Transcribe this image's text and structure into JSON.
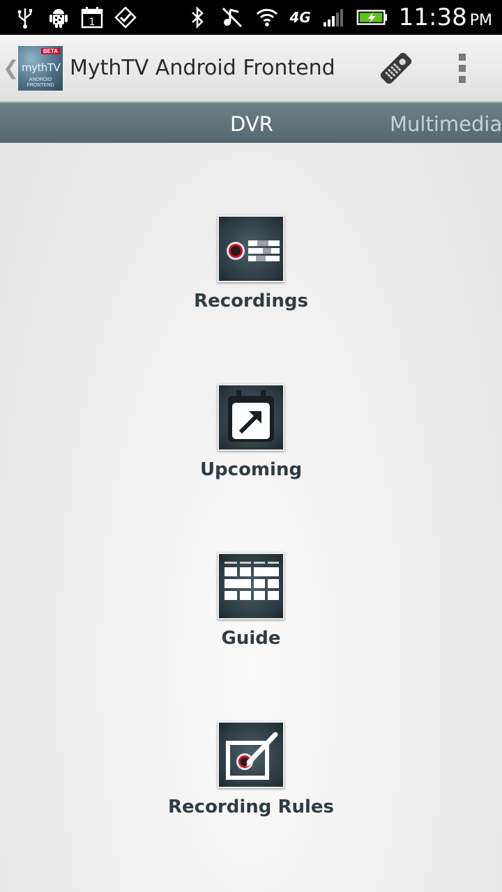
{
  "status_bar": {
    "network_label": "4G",
    "time": "11:38",
    "ampm": "PM",
    "icons_left": [
      "usb-icon",
      "android-debug-icon",
      "calendar-icon",
      "checklist-icon"
    ],
    "icons_right": [
      "bluetooth-icon",
      "mute-icon",
      "wifi-icon",
      "signal-icon",
      "battery-charging-icon"
    ],
    "calendar_day": "1"
  },
  "action_bar": {
    "title": "MythTV Android Frontend",
    "logo": {
      "badge": "BETA",
      "wordmark": "mythTV",
      "subtitle_line1": "ANDROID",
      "subtitle_line2": "FRONTEND"
    },
    "up_glyph": "❮"
  },
  "tabs": [
    {
      "label": "DVR",
      "selected": true
    },
    {
      "label": "Multimedia",
      "selected": false
    }
  ],
  "menu": [
    {
      "label": "Recordings",
      "icon": "recordings-icon"
    },
    {
      "label": "Upcoming",
      "icon": "upcoming-icon"
    },
    {
      "label": "Guide",
      "icon": "guide-icon"
    },
    {
      "label": "Recording Rules",
      "icon": "recording-rules-icon"
    }
  ],
  "colors": {
    "status_bar_bg": "#000000",
    "tab_strip_bg": "#5f7179",
    "icon_tile_bg": "#2d3b43",
    "record_red": "#c8102e",
    "label_text": "#2f3c44"
  }
}
